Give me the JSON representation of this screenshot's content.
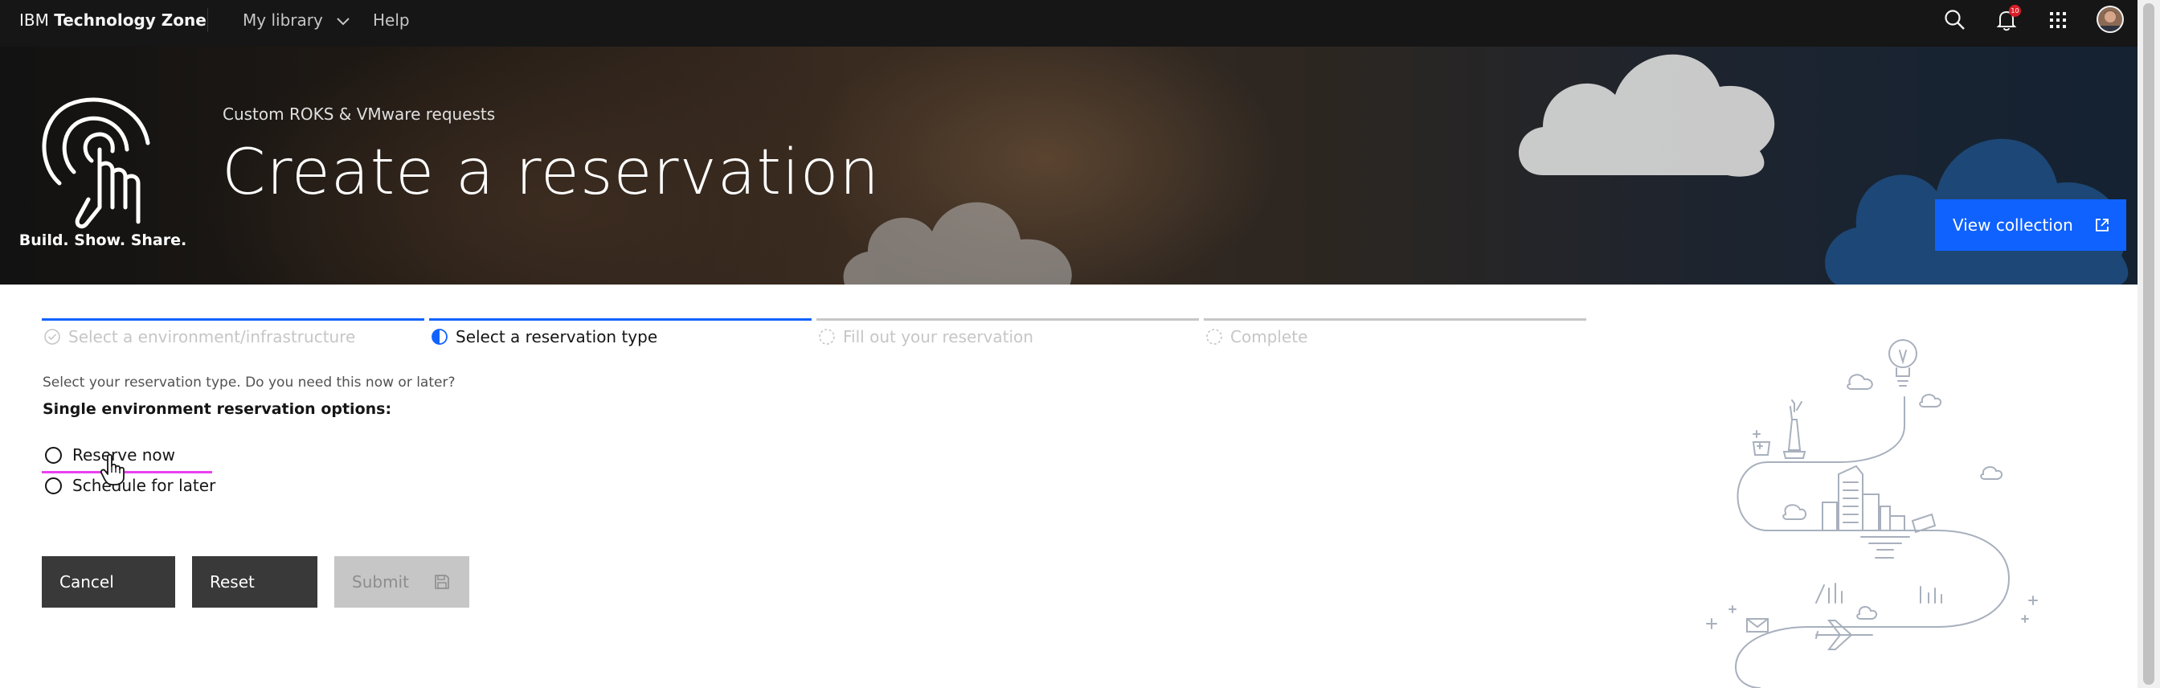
{
  "header": {
    "brand_prefix": "IBM",
    "brand_name": "Technology Zone",
    "menu": {
      "library_label": "My library",
      "help_label": "Help"
    },
    "notification_count": "10",
    "icons": [
      "search-icon",
      "notification-icon",
      "app-switcher-icon",
      "avatar"
    ]
  },
  "hero": {
    "tagline": "Build. Show. Share.",
    "subtitle": "Custom ROKS & VMware requests",
    "title": "Create a reservation",
    "view_collection_label": "View collection"
  },
  "progress": {
    "steps": [
      {
        "label": "Select a environment/infrastructure",
        "state": "complete"
      },
      {
        "label": "Select a reservation type",
        "state": "current"
      },
      {
        "label": "Fill out your reservation",
        "state": "incomplete"
      },
      {
        "label": "Complete",
        "state": "incomplete"
      }
    ]
  },
  "form": {
    "prompt": "Select your reservation type. Do you need this now or later?",
    "legend": "Single environment reservation options:",
    "options": [
      {
        "label": "Reserve now",
        "selected": false
      },
      {
        "label": "Schedule for later",
        "selected": false
      }
    ]
  },
  "actions": {
    "cancel_label": "Cancel",
    "reset_label": "Reset",
    "submit_label": "Submit",
    "submit_disabled": true
  },
  "colors": {
    "accent": "#0f62fe",
    "topbar": "#161616",
    "button_dark": "#393939",
    "button_disabled": "#c6c6c6",
    "notification_badge": "#da1e28",
    "hover_underline": "#e940f0"
  }
}
